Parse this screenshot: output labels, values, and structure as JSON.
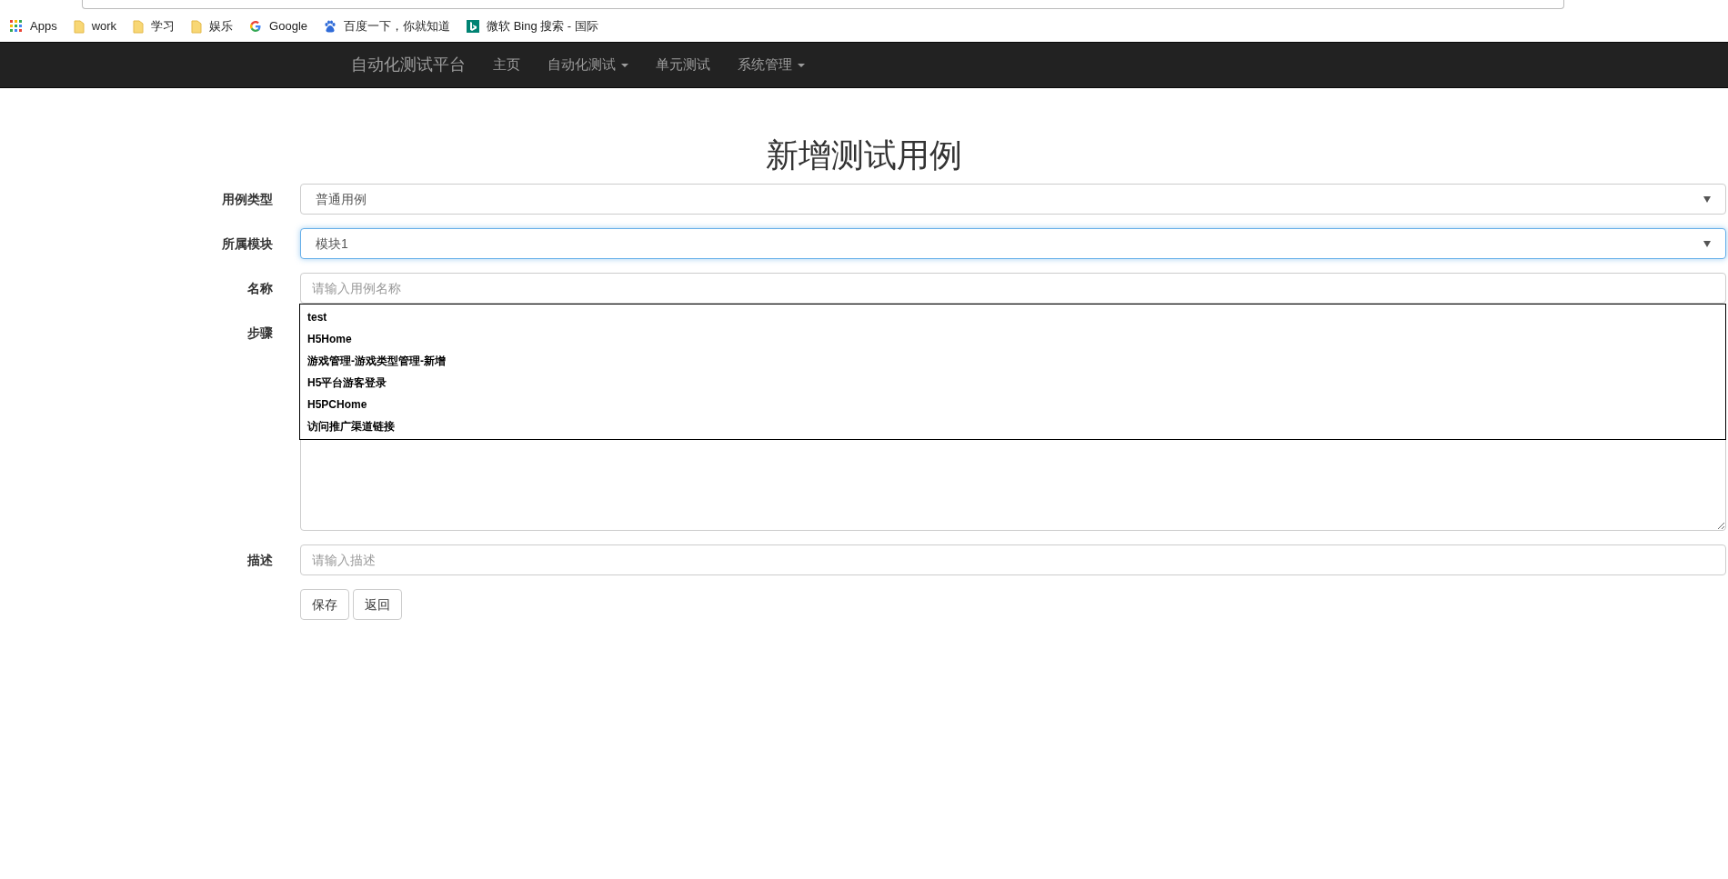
{
  "bookmarks": [
    {
      "kind": "apps",
      "label": "Apps"
    },
    {
      "kind": "folder",
      "label": "work"
    },
    {
      "kind": "folder",
      "label": "学习"
    },
    {
      "kind": "folder",
      "label": "娱乐"
    },
    {
      "kind": "google",
      "label": "Google"
    },
    {
      "kind": "baidu",
      "label": "百度一下，你就知道"
    },
    {
      "kind": "bing",
      "label": "微软 Bing 搜索 - 国际"
    }
  ],
  "navbar": {
    "brand": "自动化测试平台",
    "items": [
      {
        "label": "主页",
        "dropdown": false
      },
      {
        "label": "自动化测试",
        "dropdown": true
      },
      {
        "label": "单元测试",
        "dropdown": false
      },
      {
        "label": "系统管理",
        "dropdown": true
      }
    ]
  },
  "page_title": "新增测试用例",
  "form": {
    "fields": [
      {
        "kind": "select",
        "label": "用例类型",
        "value": "普通用例",
        "focused": false
      },
      {
        "kind": "select",
        "label": "所属模块",
        "value": "模块1",
        "focused": true
      },
      {
        "kind": "input",
        "label": "名称",
        "placeholder": "请输入用例名称",
        "focused": false
      },
      {
        "kind": "textarea",
        "label": "步骤",
        "focused": false
      },
      {
        "kind": "input",
        "label": "描述",
        "placeholder": "请输入描述",
        "focused": false
      }
    ],
    "suggestions": [
      "test",
      "H5Home",
      "游戏管理-游戏类型管理-新增",
      "H5平台游客登录",
      "H5PCHome",
      "访问推广渠道链接"
    ],
    "buttons": [
      "保存",
      "返回"
    ]
  }
}
